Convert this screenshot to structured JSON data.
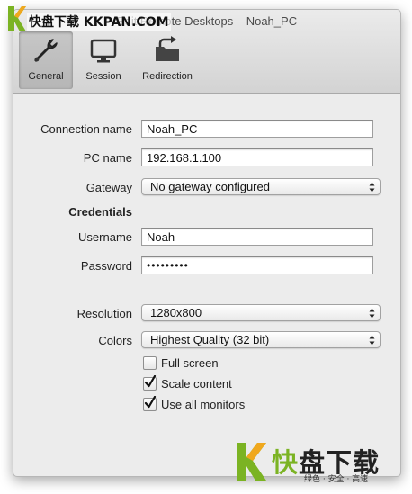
{
  "window": {
    "title": "Edit Remote Desktops – Noah_PC"
  },
  "toolbar": {
    "items": [
      {
        "label": "General",
        "icon": "wrench-icon",
        "active": true
      },
      {
        "label": "Session",
        "icon": "monitor-icon",
        "active": false
      },
      {
        "label": "Redirection",
        "icon": "folder-redirect-icon",
        "active": false
      }
    ]
  },
  "form": {
    "connection_name": {
      "label": "Connection name",
      "value": "Noah_PC"
    },
    "pc_name": {
      "label": "PC name",
      "value": "192.168.1.100"
    },
    "gateway": {
      "label": "Gateway",
      "value": "No gateway configured"
    },
    "credentials_heading": "Credentials",
    "username": {
      "label": "Username",
      "value": "Noah"
    },
    "password": {
      "label": "Password",
      "value": "•••••••••"
    },
    "resolution": {
      "label": "Resolution",
      "value": "1280x800"
    },
    "colors": {
      "label": "Colors",
      "value": "Highest Quality (32 bit)"
    },
    "full_screen": {
      "label": "Full screen",
      "checked": false
    },
    "scale_content": {
      "label": "Scale content",
      "checked": true
    },
    "use_all_monitors": {
      "label": "Use all monitors",
      "checked": true
    }
  },
  "watermark": {
    "top_text": "快盘下载 KKPAN.COM",
    "bottom_text_first": "快",
    "bottom_text_rest": "盘下载",
    "bottom_sub": "绿色 · 安全 · 高速",
    "brand_color": "#7bb323"
  }
}
